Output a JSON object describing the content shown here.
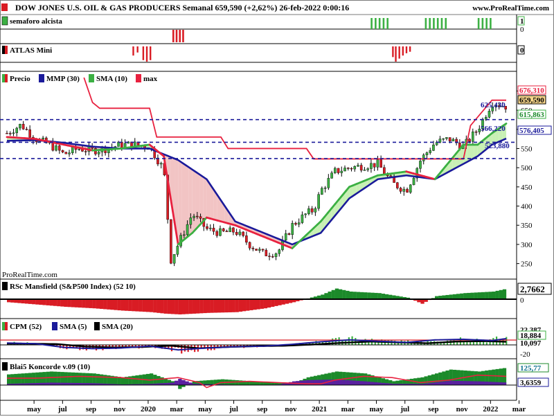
{
  "header": {
    "title": "DOW JONES U.S. OIL & GAS PRODUCERS Semanal 659,590 (+2,62%) 26-feb-2022 0:00:16",
    "site": "www.ProRealTime.com",
    "watermark": "ProRealTime.com"
  },
  "colors": {
    "bull": "#3cb043",
    "bear": "#d91c24",
    "navy": "#1a1a9a",
    "grid": "#000000",
    "fill_red": "#f2c4c4",
    "fill_green": "#c8f0b4",
    "crimson": "#e8213f",
    "purple": "#5a1fa0",
    "darkgreen": "#1c8a2a",
    "teal": "#0a6e8c"
  },
  "x_axis": {
    "labels": [
      "may",
      "jul",
      "sep",
      "nov",
      "2020",
      "mar",
      "may",
      "jul",
      "sep",
      "nov",
      "2021",
      "mar",
      "may",
      "jul",
      "sep",
      "nov",
      "2022",
      "mar"
    ]
  },
  "panels": {
    "semaforo": {
      "legend": [
        "semaforo alcista"
      ],
      "right_value": "1",
      "ticks": [
        "0"
      ]
    },
    "atlas": {
      "legend": [
        "ATLAS Mini"
      ],
      "right_value": "0"
    },
    "price": {
      "legend": [
        "Precio",
        "MMP (30)",
        "SMA (10)",
        "max"
      ],
      "y_ticks": [
        "700",
        "650",
        "600",
        "550",
        "500",
        "450",
        "400",
        "350",
        "300",
        "250"
      ],
      "right_values": {
        "max": "676,310",
        "close": "659,590",
        "sma10": "615,863",
        "mmp30": "576,405"
      },
      "levels": [
        "625,430",
        "566,220",
        "523,880"
      ]
    },
    "rsc": {
      "legend": [
        "RSc Mansfield (S&P500 Index) (52 10)"
      ],
      "right_value": "2,7662",
      "ticks": [
        "0"
      ]
    },
    "cpm": {
      "legend": [
        "CPM (52)",
        "SMA (5)",
        "SMA (20)"
      ],
      "right_values": [
        "22,387",
        "18,884",
        "10,097"
      ],
      "ticks": [
        "0",
        "-20"
      ]
    },
    "koncorde": {
      "legend": [
        "Blai5 Koncorde v.09 (10)"
      ],
      "right_values": [
        "125,77",
        "3,6359"
      ]
    }
  },
  "chart_data": {
    "type": "line",
    "title": "DOW JONES U.S. OIL & GAS PRODUCERS Semanal",
    "timeframe": "weekly",
    "x_range": [
      "2019-04",
      "2022-03"
    ],
    "ylim": [
      215,
      735
    ],
    "last_close": 659.59,
    "change_pct": 2.62,
    "date": "26-feb-2022",
    "series": [
      {
        "name": "Precio",
        "x_month_index": [
          0.0,
          1.0,
          2.0,
          3.0,
          4.0,
          5.0,
          6.0,
          7.0,
          8.0,
          9.0,
          10.0,
          11.0,
          11.5,
          12.0,
          12.5,
          13.0,
          14.0,
          15.0,
          16.0,
          17.0,
          18.0,
          19.0,
          20.0,
          21.0,
          21.5,
          22.0,
          23.0,
          24.0,
          25.0,
          26.0,
          27.0,
          28.0,
          29.0,
          30.0,
          31.0,
          32.0,
          33.0,
          34.0,
          35.0
        ],
        "values": [
          590,
          612,
          575,
          560,
          535,
          550,
          545,
          550,
          560,
          560,
          555,
          495,
          260,
          300,
          340,
          380,
          340,
          330,
          335,
          300,
          275,
          280,
          350,
          380,
          390,
          440,
          490,
          500,
          505,
          510,
          460,
          440,
          520,
          565,
          575,
          555,
          600,
          670,
          660
        ]
      },
      {
        "name": "SMA (10)",
        "x_month_index": [
          0,
          2,
          4,
          6,
          8,
          10,
          11,
          12,
          13,
          14,
          16,
          18,
          20,
          22,
          24,
          26,
          28,
          30,
          32,
          33,
          34,
          35
        ],
        "values": [
          580,
          575,
          560,
          545,
          550,
          560,
          530,
          300,
          330,
          370,
          350,
          320,
          290,
          360,
          450,
          480,
          490,
          470,
          560,
          560,
          590,
          615
        ]
      },
      {
        "name": "MMP (30)",
        "x_month_index": [
          0,
          2,
          4,
          6,
          8,
          10,
          12,
          14,
          16,
          18,
          20,
          22,
          24,
          26,
          28,
          30,
          32,
          33,
          34,
          35
        ],
        "values": [
          570,
          572,
          565,
          555,
          550,
          550,
          520,
          470,
          360,
          330,
          300,
          330,
          420,
          470,
          480,
          470,
          510,
          530,
          560,
          576
        ]
      },
      {
        "name": "max",
        "x_month_index": [
          5.4,
          6.0,
          6.5,
          10.0,
          10.5,
          15.0,
          15.5,
          21.0,
          21.5,
          32.0,
          32.5,
          34.0,
          35.0
        ],
        "values": [
          735,
          670,
          655,
          655,
          580,
          580,
          550,
          550,
          523,
          523,
          610,
          676,
          676
        ]
      }
    ],
    "horizontal_levels": [
      625.43,
      566.22,
      523.88
    ]
  }
}
